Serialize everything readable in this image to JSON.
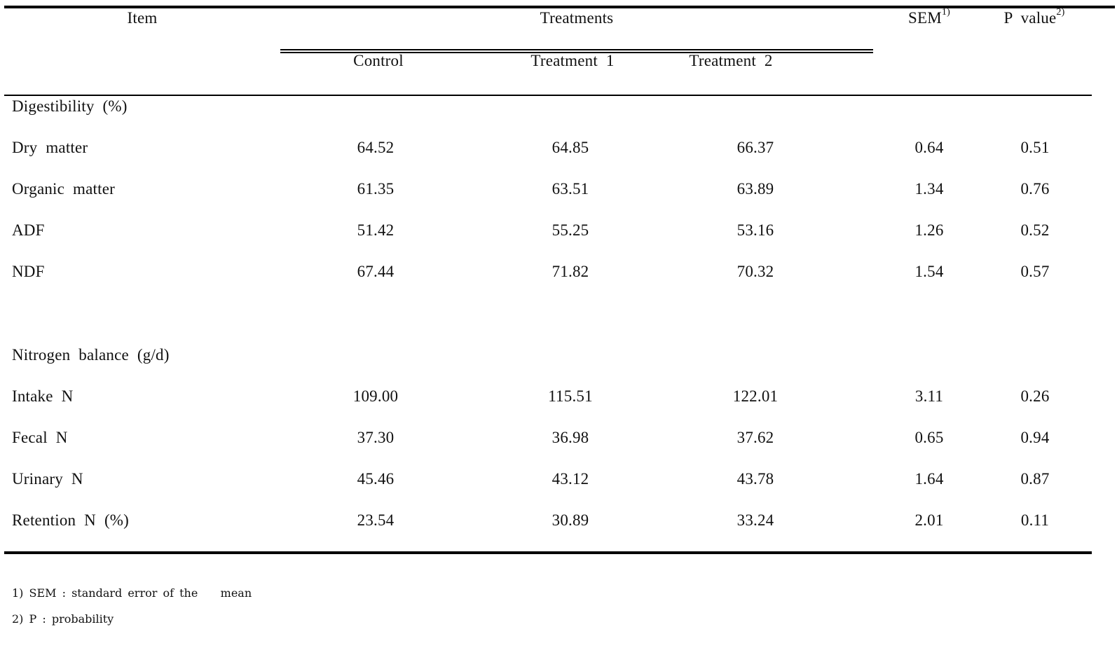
{
  "table": {
    "headers": {
      "item": "Item",
      "treatments": "Treatments",
      "sem": "SEM",
      "sem_note": "1)",
      "p_value": "P value",
      "p_value_note": "2)",
      "columns": [
        "Control",
        "Treatment 1",
        "Treatment 2"
      ]
    },
    "sections": [
      {
        "title": "Digestibility (%)",
        "rows": [
          {
            "item": "Dry matter",
            "control": "64.52",
            "t1": "64.85",
            "t2": "66.37",
            "sem": "0.64",
            "p": "0.51"
          },
          {
            "item": "Organic matter",
            "control": "61.35",
            "t1": "63.51",
            "t2": "63.89",
            "sem": "1.34",
            "p": "0.76"
          },
          {
            "item": "ADF",
            "control": "51.42",
            "t1": "55.25",
            "t2": "53.16",
            "sem": "1.26",
            "p": "0.52"
          },
          {
            "item": "NDF",
            "control": "67.44",
            "t1": "71.82",
            "t2": "70.32",
            "sem": "1.54",
            "p": "0.57"
          }
        ]
      },
      {
        "title": "Nitrogen balance (g/d)",
        "rows": [
          {
            "item": "Intake N",
            "control": "109.00",
            "t1": "115.51",
            "t2": "122.01",
            "sem": "3.11",
            "p": "0.26"
          },
          {
            "item": "Fecal N",
            "control": "37.30",
            "t1": "36.98",
            "t2": "37.62",
            "sem": "0.65",
            "p": "0.94"
          },
          {
            "item": "Urinary N",
            "control": "45.46",
            "t1": "43.12",
            "t2": "43.78",
            "sem": "1.64",
            "p": "0.87"
          },
          {
            "item": "Retention N (%)",
            "control": "23.54",
            "t1": "30.89",
            "t2": "33.24",
            "sem": "2.01",
            "p": "0.11"
          }
        ]
      }
    ]
  },
  "footnotes": [
    "1) SEM : standard error of the    mean",
    "2) P : probability"
  ]
}
